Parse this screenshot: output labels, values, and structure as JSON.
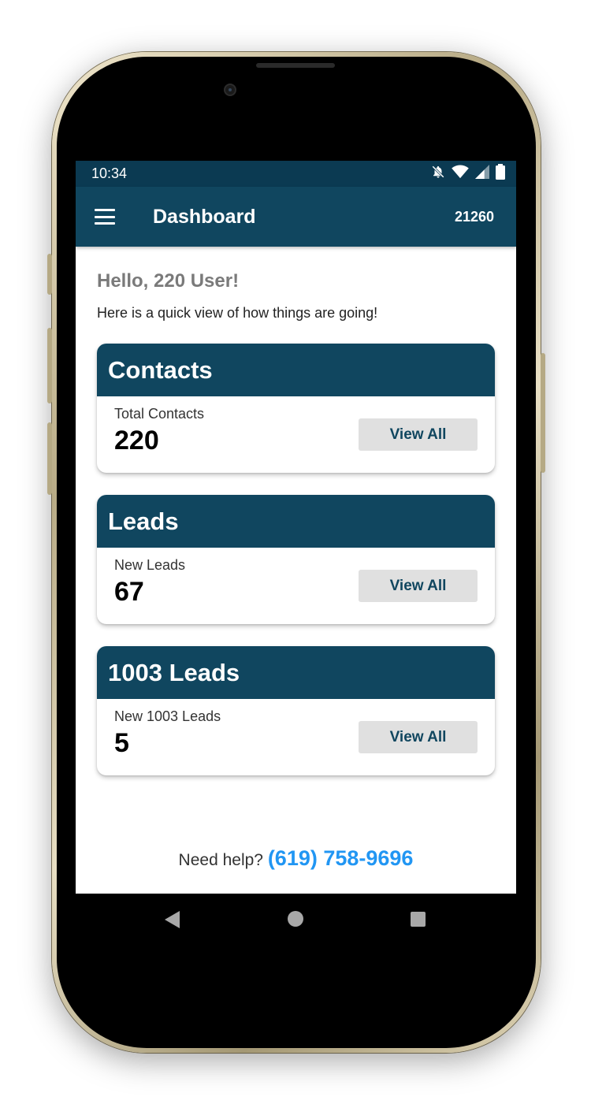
{
  "status_bar": {
    "time": "10:34",
    "icons": [
      "bell-off-icon",
      "wifi-icon",
      "signal-icon",
      "battery-icon"
    ]
  },
  "app_bar": {
    "menu_icon": "hamburger-menu-icon",
    "title": "Dashboard",
    "code": "21260"
  },
  "greeting": {
    "title": "Hello, 220 User!",
    "subtitle": "Here is a quick view of how things are going!"
  },
  "cards": [
    {
      "title": "Contacts",
      "label": "Total Contacts",
      "value": "220",
      "button": "View All"
    },
    {
      "title": "Leads",
      "label": "New Leads",
      "value": "67",
      "button": "View All"
    },
    {
      "title": "1003 Leads",
      "label": "New 1003 Leads",
      "value": "5",
      "button": "View All"
    }
  ],
  "help": {
    "text": "Need help?",
    "phone": "(619) 758-9696"
  },
  "nav": [
    "back-icon",
    "home-icon",
    "recent-apps-icon"
  ],
  "colors": {
    "primary": "#10465f",
    "status_bar": "#0b3a52",
    "link": "#2196f3",
    "button_bg": "#e0e0e0"
  }
}
